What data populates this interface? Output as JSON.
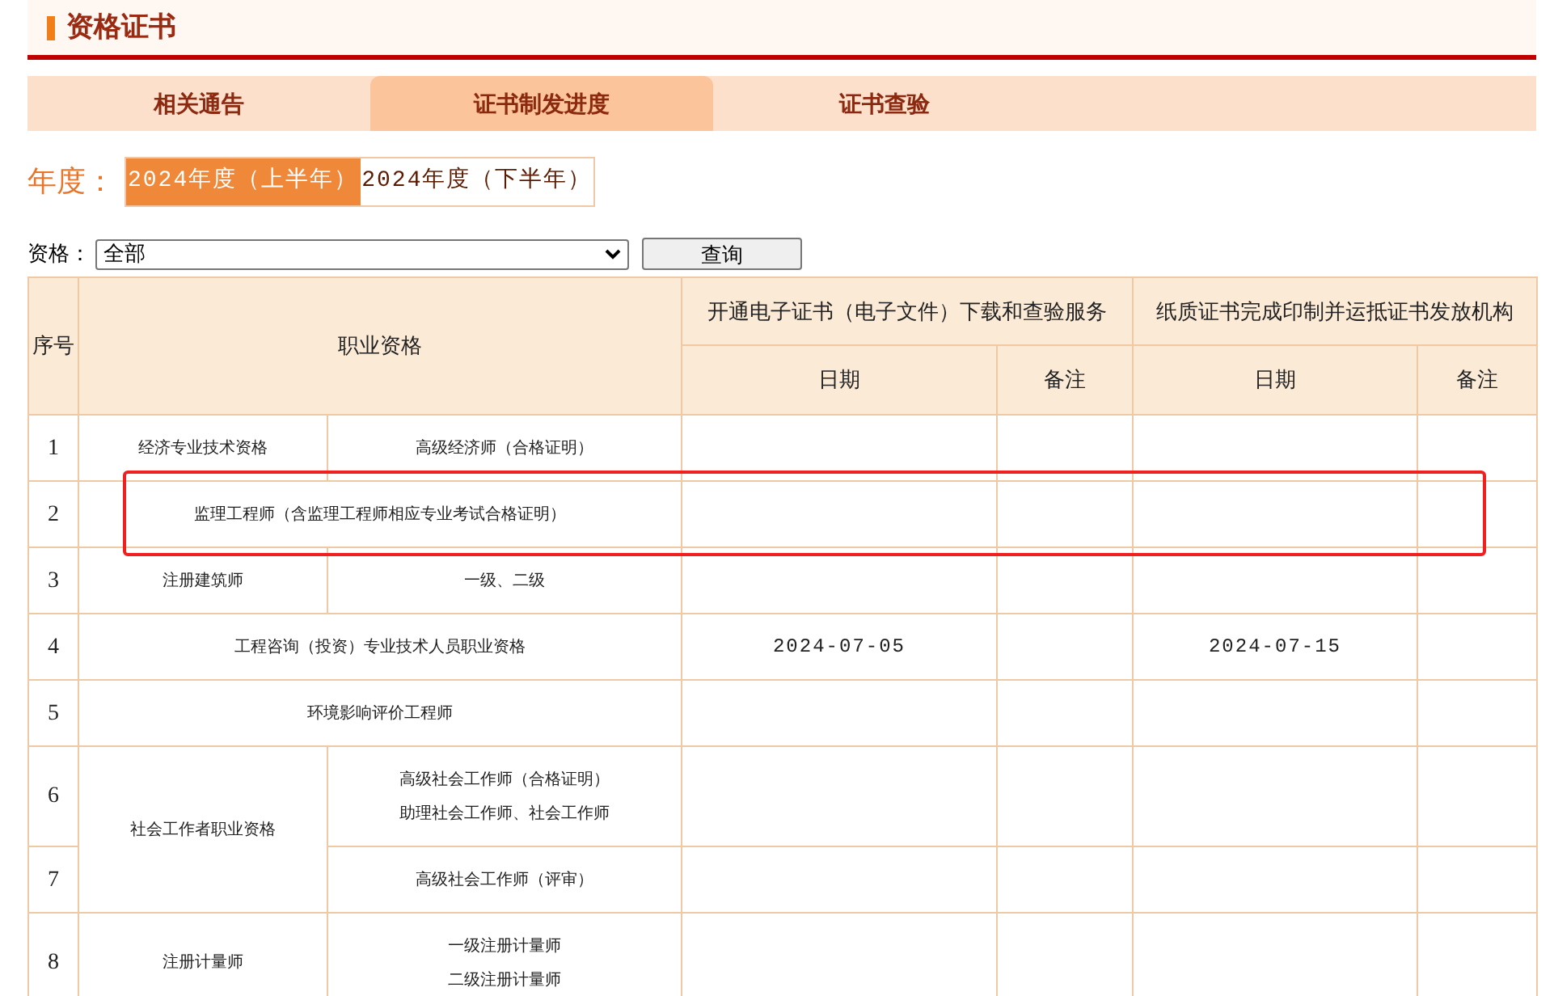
{
  "page_title": "资格证书",
  "tabs": [
    {
      "label": "相关通告",
      "selected": false
    },
    {
      "label": "证书制发进度",
      "selected": true
    },
    {
      "label": "证书查验",
      "selected": false
    }
  ],
  "year": {
    "label": "年度：",
    "options": [
      {
        "label": "2024年度（上半年）",
        "selected": true
      },
      {
        "label": "2024年度（下半年）",
        "selected": false
      }
    ]
  },
  "filter": {
    "label": "资格：",
    "value": "全部",
    "button": "查询"
  },
  "table": {
    "columns": {
      "no": "序号",
      "qualification": "职业资格",
      "electronic": "开通电子证书（电子文件）下载和查验服务",
      "paper": "纸质证书完成印制并运抵证书发放机构",
      "e_date": "日期",
      "e_note": "备注",
      "p_date": "日期",
      "p_note": "备注"
    },
    "groups": [
      {
        "qualification": "经济专业技术资格",
        "entries": [
          {
            "no": "1",
            "levels": [
              "高级经济师（合格证明）"
            ],
            "highlighted": false
          }
        ]
      },
      {
        "qualification": "监理工程师（含监理工程师相应专业考试合格证明）",
        "entries": [
          {
            "no": "2",
            "highlighted": true
          }
        ]
      },
      {
        "qualification": "注册建筑师",
        "entries": [
          {
            "no": "3",
            "levels": [
              "一级、二级"
            ],
            "highlighted": false
          }
        ]
      },
      {
        "qualification": "工程咨询（投资）专业技术人员职业资格",
        "entries": [
          {
            "no": "4",
            "e_date": "2024-07-05",
            "p_date": "2024-07-15",
            "highlighted": false
          }
        ]
      },
      {
        "qualification": "环境影响评价工程师",
        "entries": [
          {
            "no": "5",
            "highlighted": false
          }
        ]
      },
      {
        "qualification": "社会工作者职业资格",
        "entries": [
          {
            "no": "6",
            "levels": [
              "高级社会工作师（合格证明）",
              "助理社会工作师、社会工作师"
            ],
            "highlighted": false
          },
          {
            "no": "7",
            "levels": [
              "高级社会工作师（评审）"
            ],
            "highlighted": false
          }
        ]
      },
      {
        "qualification": "注册计量师",
        "entries": [
          {
            "no": "8",
            "levels": [
              "一级注册计量师",
              "二级注册计量师"
            ],
            "highlighted": false
          }
        ]
      }
    ]
  }
}
